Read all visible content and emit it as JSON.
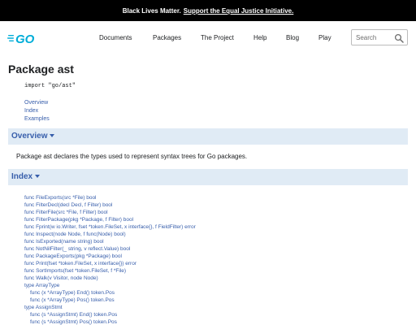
{
  "banner": {
    "text": "Black Lives Matter.",
    "link": "Support the Equal Justice Initiative."
  },
  "header": {
    "logo_text": "GO",
    "nav": [
      "Documents",
      "Packages",
      "The Project",
      "Help",
      "Blog",
      "Play"
    ],
    "search_placeholder": "Search"
  },
  "page": {
    "title": "Package ast",
    "import_line": "import \"go/ast\"",
    "toc": [
      "Overview",
      "Index",
      "Examples"
    ]
  },
  "overview": {
    "heading": "Overview",
    "text": "Package ast declares the types used to represent syntax trees for Go packages."
  },
  "index": {
    "heading": "Index",
    "items": [
      {
        "text": "func FileExports(src *File) bool",
        "method": false
      },
      {
        "text": "func FilterDecl(decl Decl, f Filter) bool",
        "method": false
      },
      {
        "text": "func FilterFile(src *File, f Filter) bool",
        "method": false
      },
      {
        "text": "func FilterPackage(pkg *Package, f Filter) bool",
        "method": false
      },
      {
        "text": "func Fprint(w io.Writer, fset *token.FileSet, x interface{}, f FieldFilter) error",
        "method": false
      },
      {
        "text": "func Inspect(node Node, f func(Node) bool)",
        "method": false
      },
      {
        "text": "func IsExported(name string) bool",
        "method": false
      },
      {
        "text": "func NotNilFilter(_ string, v reflect.Value) bool",
        "method": false
      },
      {
        "text": "func PackageExports(pkg *Package) bool",
        "method": false
      },
      {
        "text": "func Print(fset *token.FileSet, x interface{}) error",
        "method": false
      },
      {
        "text": "func SortImports(fset *token.FileSet, f *File)",
        "method": false
      },
      {
        "text": "func Walk(v Visitor, node Node)",
        "method": false
      },
      {
        "text": "type ArrayType",
        "method": false
      },
      {
        "text": "func (x *ArrayType) End() token.Pos",
        "method": true
      },
      {
        "text": "func (x *ArrayType) Pos() token.Pos",
        "method": true
      },
      {
        "text": "type AssignStmt",
        "method": false
      },
      {
        "text": "func (s *AssignStmt) End() token.Pos",
        "method": true
      },
      {
        "text": "func (s *AssignStmt) Pos() token.Pos",
        "method": true
      }
    ]
  },
  "colors": {
    "banner_bg": "#000000",
    "link": "#375eab",
    "logo": "#00add8",
    "section_bg": "#e0ebf5",
    "text": "#202224"
  }
}
